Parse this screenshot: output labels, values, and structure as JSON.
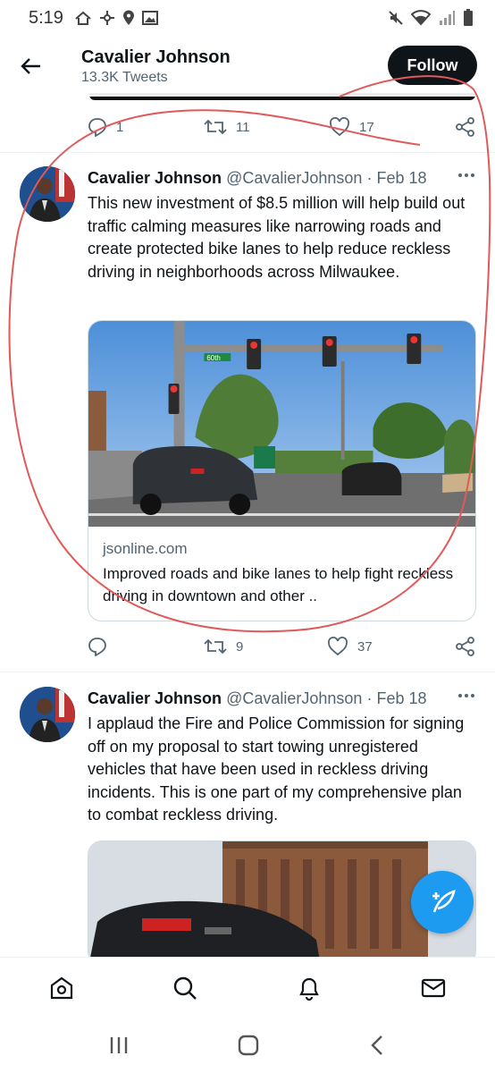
{
  "status_bar": {
    "time": "5:19"
  },
  "header": {
    "name": "Cavalier Johnson",
    "tweet_count": "13.3K Tweets",
    "follow_label": "Follow"
  },
  "prev_tweet_actions": {
    "replies": "1",
    "retweets": "11",
    "likes": "17"
  },
  "tweets": [
    {
      "name": "Cavalier Johnson",
      "handle": "@CavalierJohnson",
      "separator": "·",
      "date": "Feb 18",
      "text": "This new investment of $8.5 million will help build out traffic calming measures like narrowing roads and create protected bike lanes to help reduce reckless driving in neighborhoods across Milwaukee.",
      "card": {
        "domain": "jsonline.com",
        "title": "Improved roads and bike lanes to help fight reckless driving in downtown and other ..",
        "sign_text": "60th"
      },
      "actions": {
        "replies": "",
        "retweets": "9",
        "likes": "37"
      }
    },
    {
      "name": "Cavalier Johnson",
      "handle": "@CavalierJohnson",
      "separator": "·",
      "date": "Feb 18",
      "text": "I applaud the Fire and Police Commission for signing off on my proposal to start towing unregistered vehicles that have been used in reckless driving incidents. This is one part of my comprehensive plan to combat reckless driving."
    }
  ],
  "icons": {
    "back": "arrow-left-icon",
    "compose": "compose-tweet-icon",
    "nav": [
      "home-icon",
      "search-icon",
      "notifications-icon",
      "messages-icon"
    ],
    "system": [
      "recent-apps-icon",
      "home-button-icon",
      "back-nav-icon"
    ]
  },
  "colors": {
    "accent": "#1d9bf0",
    "annotation": "#e05a5a",
    "text": "#0f1419",
    "secondary": "#536471"
  }
}
